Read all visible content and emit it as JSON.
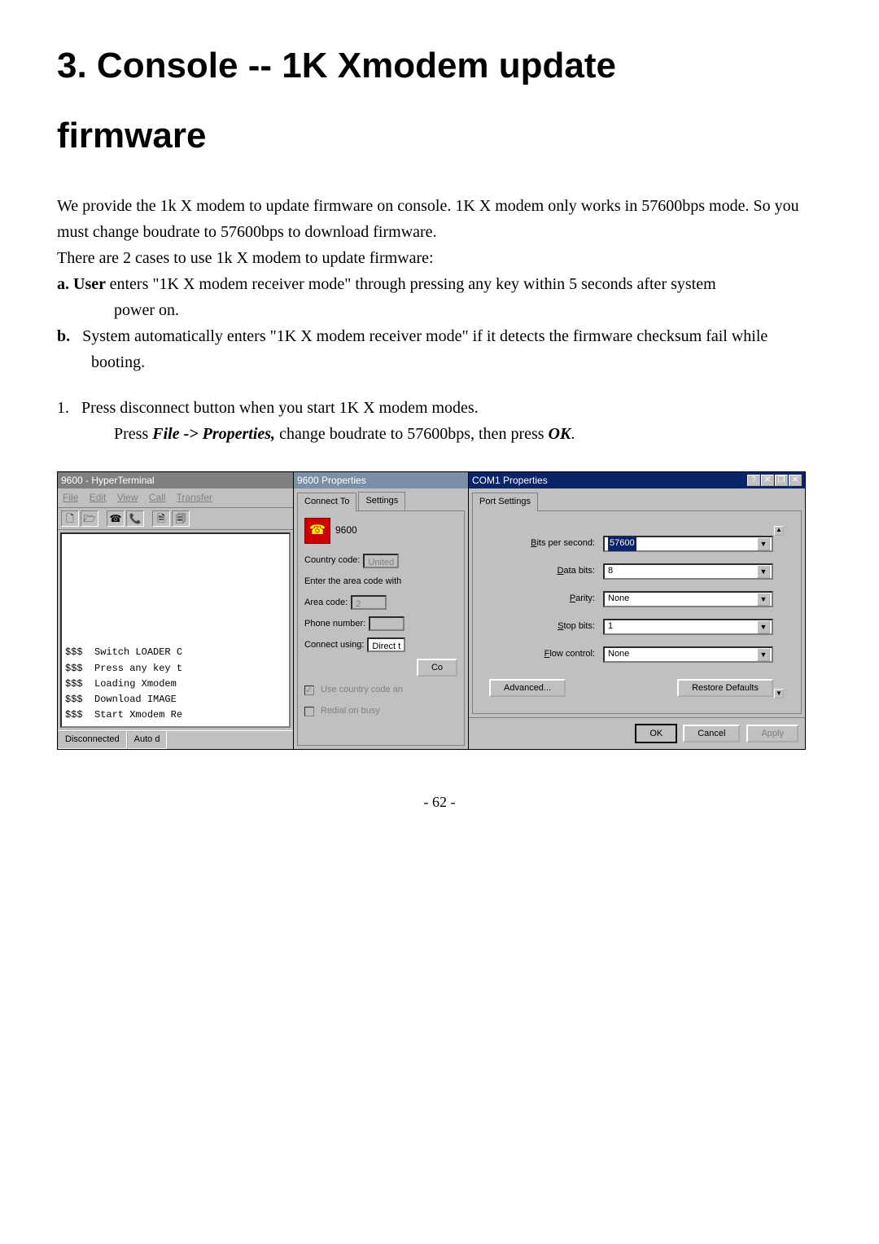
{
  "doc": {
    "title_a": "3. Console -- 1K Xmodem update",
    "title_b": "firmware",
    "intro1": "We provide the 1k X modem to update firmware on console. 1K X modem only works in 57600bps mode. So you must change boudrate to 57600bps to download firmware.",
    "intro2": "There are 2 cases to use 1k X modem to update firmware:",
    "item_a_prefix": "a. User ",
    "item_a_body_lead": "enters \"1K X modem receiver mode\" through pressing any key within 5 seconds after system",
    "item_a_tail": "power on.",
    "item_b_prefix": "b.",
    "item_b_body": "System automatically enters \"1K X modem receiver mode\" if it detects the firmware checksum fail while booting.",
    "step1_prefix": "1.",
    "step1_body": "Press disconnect button when you start 1K X modem modes.",
    "step1_follow_pre": "Press ",
    "step1_follow_em": "File -> Properties,",
    "step1_follow_post": " change boudrate to 57600bps, then press ",
    "step1_follow_ok": "OK",
    "step1_follow_end": ".",
    "pagenum": "- 62 -"
  },
  "hyper": {
    "title": "9600 - HyperTerminal",
    "menu": {
      "file": "File",
      "edit": "Edit",
      "view": "View",
      "call": "Call",
      "transfer": "Transfer"
    },
    "toolbar": {
      "b1": "🗋",
      "b2": "🗁",
      "div": "",
      "b3": "☎",
      "b4": "📞",
      "b5": "🗎",
      "b6": "🗐"
    },
    "terminal_lines": [
      "$$$  Switch LOADER C",
      "$$$  Press any key t",
      "$$$  Loading Xmodem",
      "",
      "$$$  Download IMAGE",
      "$$$  Start Xmodem Re"
    ],
    "status": {
      "left": "Disconnected",
      "right": "Auto d"
    }
  },
  "props": {
    "title": "9600 Properties",
    "tab1": "Connect To",
    "tab2": "Settings",
    "icon_label": "9600",
    "country_label": "Country code:",
    "country_value": "United",
    "enter_area": "Enter the area code with",
    "area_label": "Area code:",
    "area_value": "2",
    "phone_label": "Phone number:",
    "connect_label": "Connect using:",
    "connect_value": "Direct t",
    "co_btn": "Co",
    "chk1": "Use country code an",
    "chk2": "Redial on busy"
  },
  "com": {
    "title": "COM1 Properties",
    "tab": "Port Settings",
    "bits_label": "Bits per second:",
    "bits_value": "57600",
    "databits_label": "Data bits:",
    "databits_value": "8",
    "parity_label": "Parity:",
    "parity_value": "None",
    "stopbits_label": "Stop bits:",
    "stopbits_value": "1",
    "flow_label": "Flow control:",
    "flow_value": "None",
    "advanced": "Advanced...",
    "restore": "Restore Defaults",
    "ok": "OK",
    "cancel": "Cancel",
    "apply": "Apply"
  },
  "winbuttons": {
    "help": "?",
    "close": "✕",
    "restore": "❐"
  }
}
